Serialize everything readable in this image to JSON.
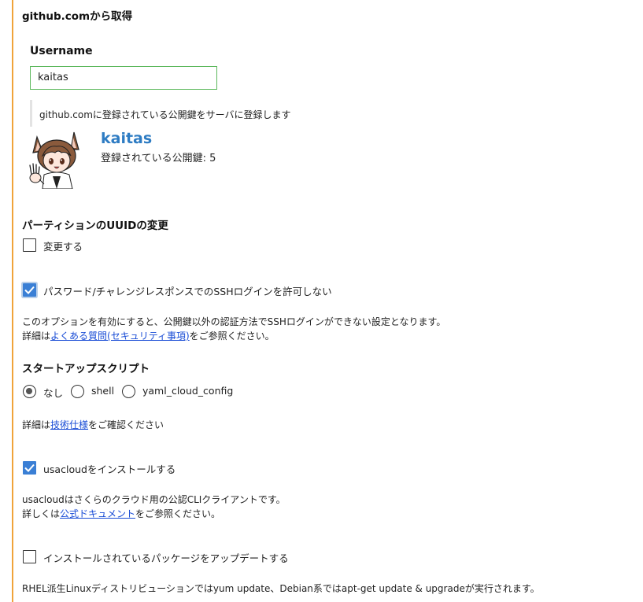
{
  "github_section": {
    "title": "github.comから取得",
    "username_label": "Username",
    "username_value": "kaitas",
    "description": "github.comに登録されている公開鍵をサーバに登録します",
    "profile": {
      "name": "kaitas",
      "key_count_text": "登録されている公開鍵: 5"
    }
  },
  "uuid_section": {
    "title": "パーティションのUUIDの変更",
    "checkbox_label": "変更する",
    "checked": false
  },
  "ssh_option": {
    "checkbox_label": "パスワード/チャレンジレスポンスでのSSHログインを許可しない",
    "checked": true,
    "note_line1": "このオプションを有効にすると、公開鍵以外の認証方法でSSHログインができない設定となります。",
    "note_prefix": "詳細は",
    "note_link": "よくある質問(セキュリティ事項)",
    "note_suffix": "をご参照ください。"
  },
  "startup_script": {
    "title": "スタートアップスクリプト",
    "options": [
      "なし",
      "shell",
      "yaml_cloud_config"
    ],
    "selected": "なし",
    "note_prefix": "詳細は",
    "note_link": "技術仕様",
    "note_suffix": "をご確認ください"
  },
  "usacloud": {
    "checkbox_label": "usacloudをインストールする",
    "checked": true,
    "note_line1": "usacloudはさくらのクラウド用の公認CLIクライアントです。",
    "note_prefix": "詳しくは",
    "note_link": "公式ドキュメント",
    "note_suffix": "をご参照ください。"
  },
  "package_update": {
    "checkbox_label": "インストールされているパッケージをアップデートする",
    "checked": false,
    "note": "RHEL派生Linuxディストリビューションではyum update、Debian系ではapt-get update & upgradeが実行されます。"
  },
  "colors": {
    "accent_rule": "#f0a33a",
    "input_border": "#5cb85c",
    "checkbox_checked": "#3a7fd5",
    "profile_link": "#2e7cc3",
    "text_link": "#1a4dd6"
  }
}
